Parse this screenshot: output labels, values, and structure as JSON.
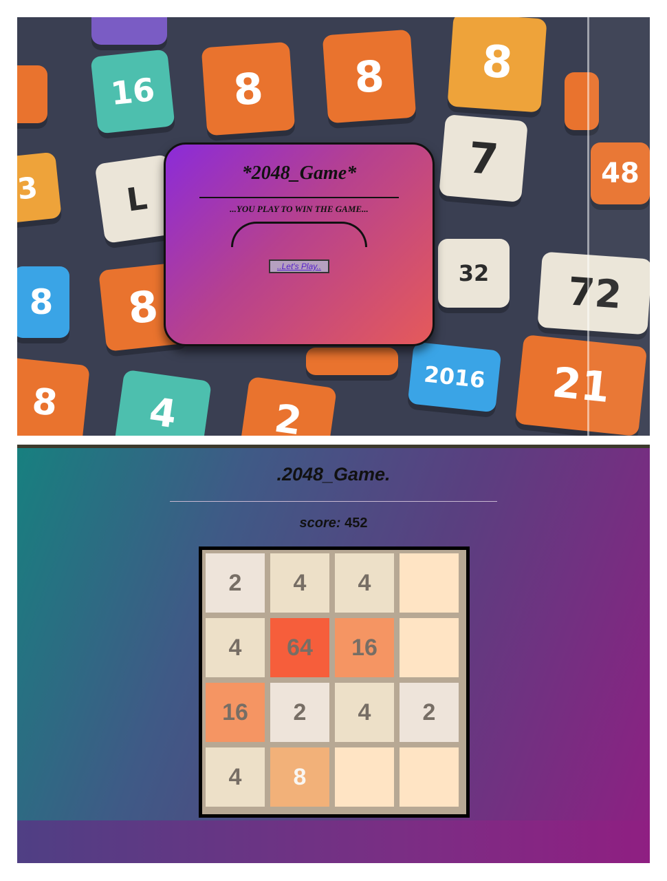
{
  "splash": {
    "title": "*2048_Game*",
    "tagline": "...YOU PLAY TO WIN THE GAME...",
    "play_button": "..Let's Play.."
  },
  "background_tiles": [
    "16",
    "8",
    "8",
    "8",
    "7",
    "3",
    "L",
    "48",
    "8",
    "8",
    "32",
    "72",
    "2016",
    "21",
    "8",
    "4",
    "2"
  ],
  "game": {
    "title": ".2048_Game.",
    "score_label": "score:",
    "score_value": "452",
    "grid": [
      [
        "2",
        "4",
        "4",
        ""
      ],
      [
        "4",
        "64",
        "16",
        ""
      ],
      [
        "16",
        "2",
        "4",
        "2"
      ],
      [
        "4",
        "8",
        "",
        ""
      ]
    ]
  },
  "colors": {
    "empty": "#ffe4c4",
    "tile_2": "#eee4da",
    "tile_4": "#ede0c8",
    "tile_8": "#f2b179",
    "tile_16": "#f59563",
    "tile_64": "#f65e3b",
    "board": "#b7a894"
  }
}
